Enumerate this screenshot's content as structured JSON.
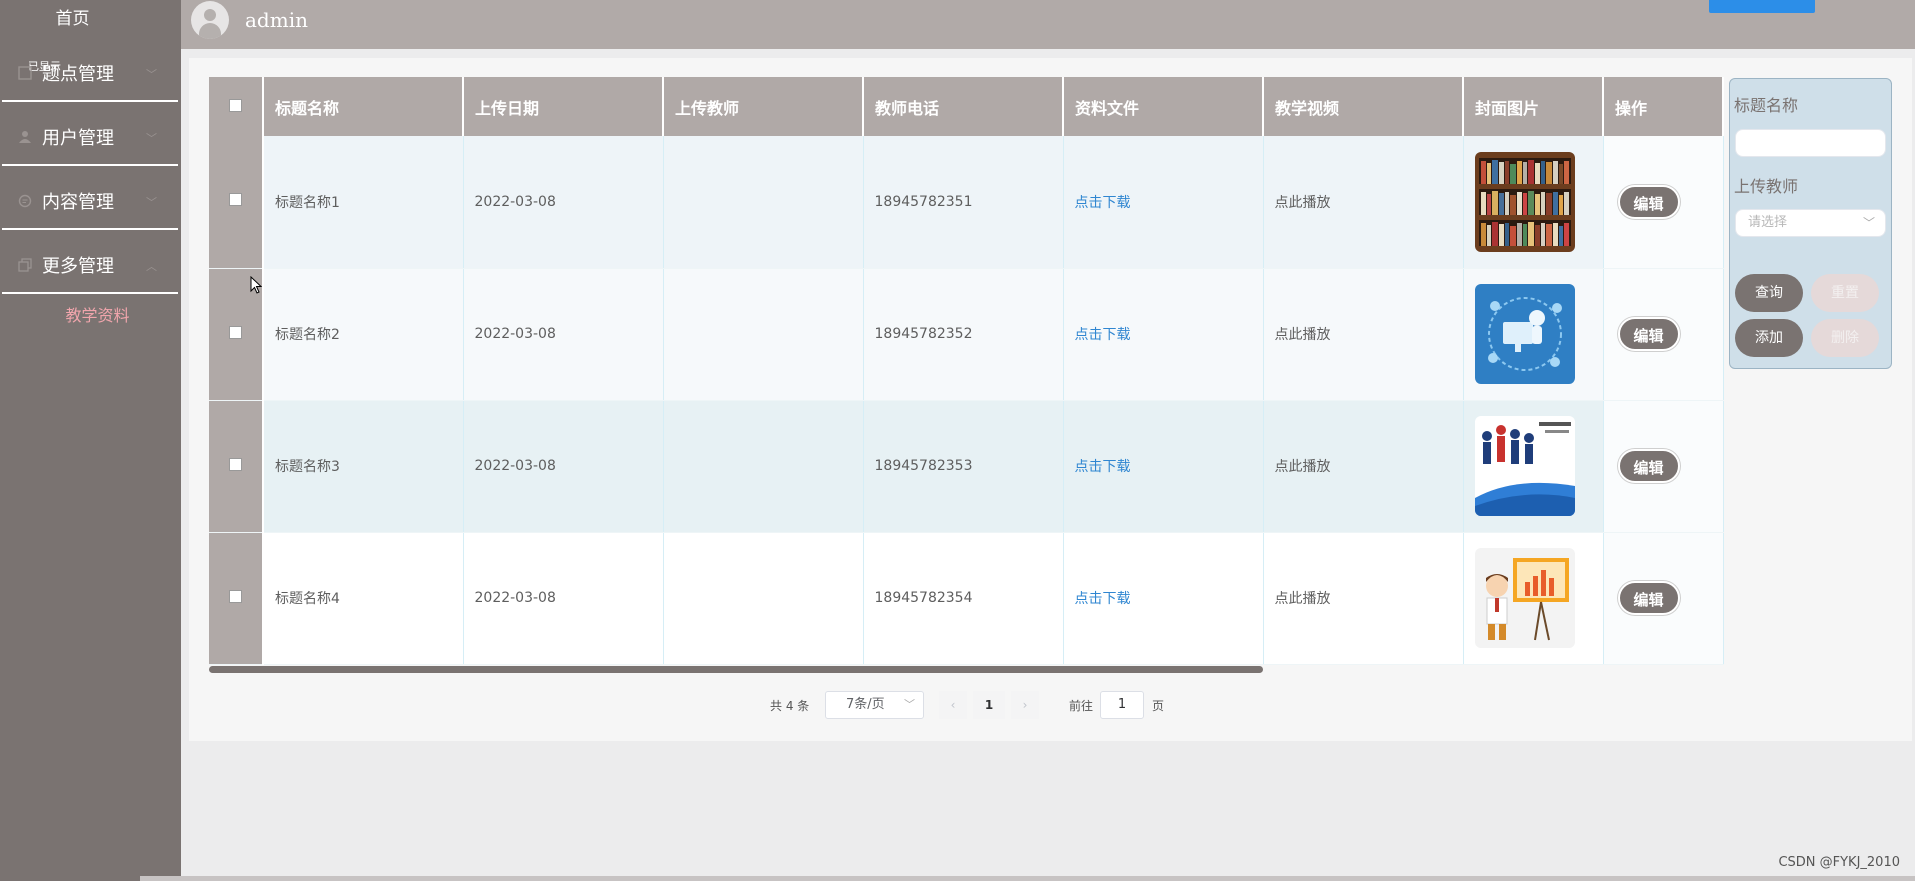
{
  "sidebar": {
    "home": "首页",
    "ghost_text": "已显示",
    "groups": [
      {
        "label": "题点管理",
        "icon": "document-icon"
      },
      {
        "label": "用户管理",
        "icon": "user-icon"
      },
      {
        "label": "内容管理",
        "icon": "chat-icon"
      },
      {
        "label": "更多管理",
        "icon": "copy-icon"
      }
    ],
    "sub_item": "教学资料"
  },
  "header": {
    "username": "admin"
  },
  "table": {
    "columns": [
      "标题名称",
      "上传日期",
      "上传教师",
      "教师电话",
      "资料文件",
      "教学视频",
      "封面图片",
      "操作"
    ],
    "rows": [
      {
        "title": "标题名称1",
        "date": "2022-03-08",
        "teacher": "",
        "phone": "18945782351",
        "file": "点击下载",
        "video": "点此播放",
        "edit": "编辑"
      },
      {
        "title": "标题名称2",
        "date": "2022-03-08",
        "teacher": "",
        "phone": "18945782352",
        "file": "点击下载",
        "video": "点此播放",
        "edit": "编辑"
      },
      {
        "title": "标题名称3",
        "date": "2022-03-08",
        "teacher": "",
        "phone": "18945782353",
        "file": "点击下载",
        "video": "点此播放",
        "edit": "编辑"
      },
      {
        "title": "标题名称4",
        "date": "2022-03-08",
        "teacher": "",
        "phone": "18945782354",
        "file": "点击下载",
        "video": "点此播放",
        "edit": "编辑"
      }
    ]
  },
  "pager": {
    "total": "共 4 条",
    "page_size": "7条/页",
    "current_page": "1",
    "goto_label": "前往",
    "goto_value": "1",
    "page_unit": "页"
  },
  "search": {
    "title_label": "标题名称",
    "title_value": "",
    "teacher_label": "上传教师",
    "teacher_placeholder": "请选择",
    "query_btn": "查询",
    "reset_btn": "重置",
    "add_btn": "添加",
    "delete_btn": "删除"
  },
  "watermark": "CSDN @FYKJ_2010",
  "colors": {
    "sidebar": "#7a7371",
    "header": "#b1aaa8",
    "accent_pink": "#f0a5ac",
    "link_blue": "#2f86d1"
  }
}
